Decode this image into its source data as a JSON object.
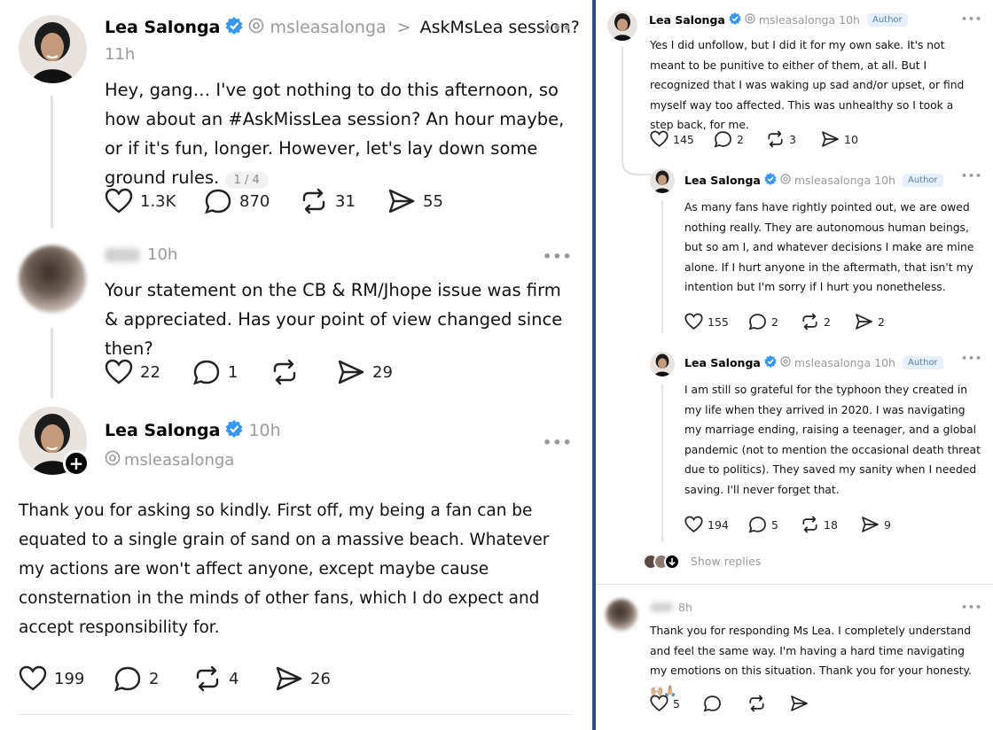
{
  "left": {
    "post1": {
      "author": "Lea Salonga",
      "handle": "msleasalonga",
      "topic_chevron": ">",
      "topic": "AskMsLea session?",
      "time": "11h",
      "text": "Hey, gang… I've got nothing to do this afternoon, so how about an #AskMissLea session? An hour maybe, or if it's fun, longer. However, let's lay down some ground rules.",
      "page_counter": "1 / 4",
      "likes": "1.3K",
      "replies": "870",
      "reposts": "31",
      "shares": "55"
    },
    "post2": {
      "time": "10h",
      "text": "Your statement on the CB & RM/Jhope issue was firm & appreciated. Has your point of view changed since then?",
      "likes": "22",
      "replies": "1",
      "reposts": "",
      "shares": "29"
    },
    "post3": {
      "author": "Lea Salonga",
      "handle": "msleasalonga",
      "time": "10h",
      "text": "Thank you for asking so kindly. First off, my being a fan can be equated to a single grain of sand on a massive beach. Whatever my actions are won't affect anyone, except maybe cause consternation in the minds of other fans, which I do expect and accept responsibility for.",
      "likes": "199",
      "replies": "2",
      "reposts": "4",
      "shares": "26"
    }
  },
  "right": {
    "reply1": {
      "author": "Lea Salonga",
      "handle": "msleasalonga",
      "time": "10h",
      "badge": "Author",
      "text": "Yes I did unfollow, but I did it for my own sake. It's not meant to be punitive to either of them, at all. But I recognized that I was waking up sad and/or upset, or find myself way too affected. This was unhealthy so I took a step back, for me.",
      "likes": "145",
      "replies": "2",
      "reposts": "3",
      "shares": "10"
    },
    "reply2": {
      "author": "Lea Salonga",
      "handle": "msleasalonga",
      "time": "10h",
      "badge": "Author",
      "text": "As many fans have rightly pointed out, we are owed nothing really. They are autonomous human beings, but so am I, and whatever decisions I make are mine alone. If I hurt anyone in the aftermath, that isn't my intention but I'm sorry if I hurt you nonetheless.",
      "likes": "155",
      "replies": "2",
      "reposts": "2",
      "shares": "2"
    },
    "reply3": {
      "author": "Lea Salonga",
      "handle": "msleasalonga",
      "time": "10h",
      "badge": "Author",
      "text": "I am still so grateful for the typhoon they created in my life when they arrived in 2020. I was navigating my marriage ending, raising a teenager, and a global pandemic (not to mention the occasional death threat due to politics). They saved my sanity when I needed saving. I'll never forget that.",
      "likes": "194",
      "replies": "5",
      "reposts": "18",
      "shares": "9"
    },
    "show_replies": "Show replies",
    "reply4": {
      "time": "8h",
      "text": "Thank you for responding Ms Lea. I completely understand and feel the same way. I'm having a hard time navigating my emotions on this situation. Thank you for your honesty.",
      "emoji": "🙌🏼🙏🏼",
      "likes": "5"
    }
  },
  "colors": {
    "verified": "#3897f0",
    "divider": "#2a4f86",
    "author_badge_bg": "#e6f0fb",
    "muted": "#9a9a9a"
  },
  "icons": [
    "heart-icon",
    "comment-icon",
    "repost-icon",
    "share-icon",
    "verified-icon",
    "threads-icon",
    "more-icon",
    "follow-plus-icon",
    "show-replies-arrow-icon"
  ]
}
